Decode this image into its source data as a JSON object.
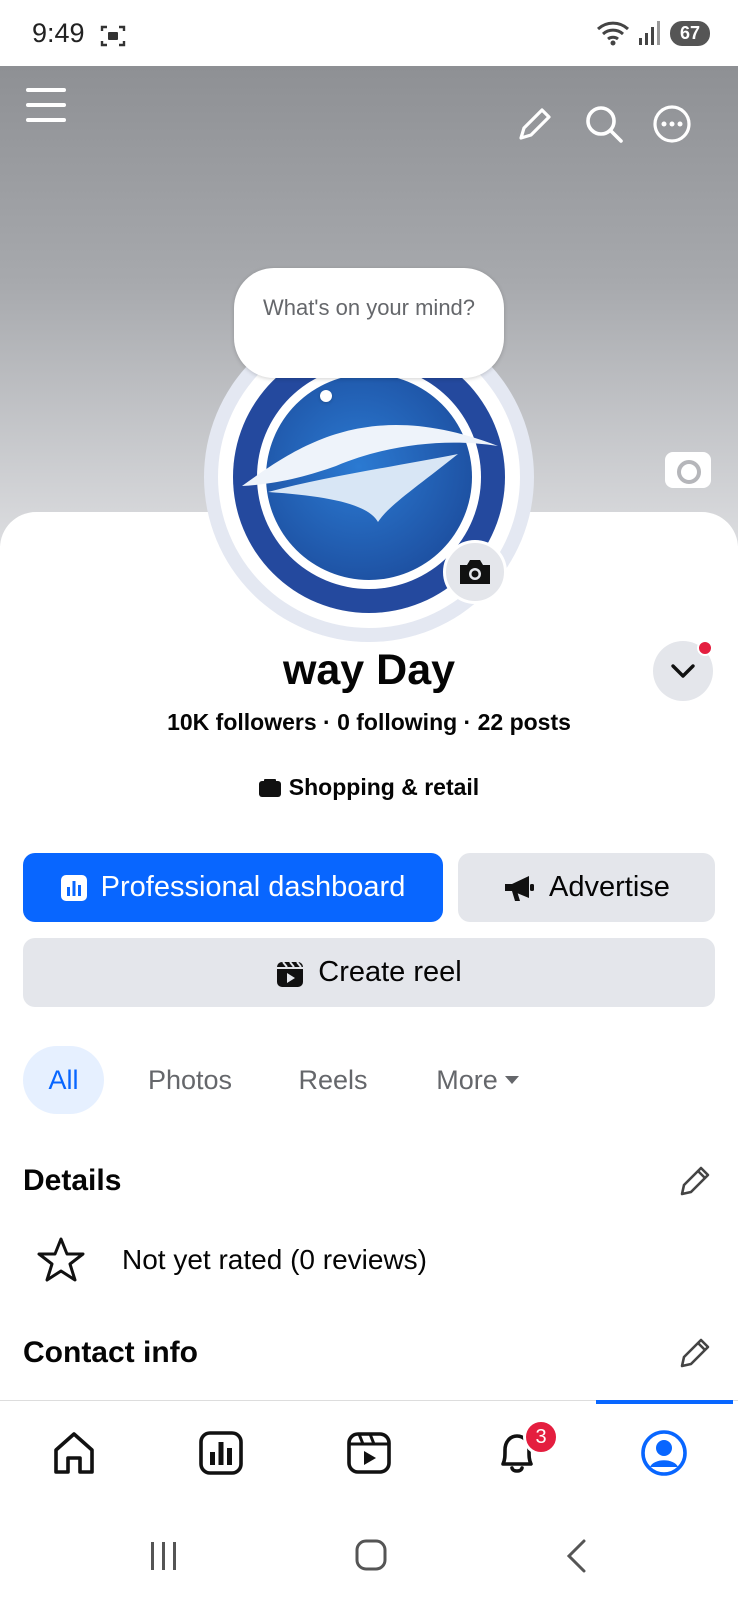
{
  "status_bar": {
    "time": "9:49",
    "battery": "67"
  },
  "profile": {
    "bubble_text": "What's on your mind?",
    "name": "way Day",
    "stats": "10K followers · 0 following · 22 posts",
    "category": "Shopping & retail"
  },
  "buttons": {
    "professional_dashboard": "Professional dashboard",
    "advertise": "Advertise",
    "create_reel": "Create reel"
  },
  "filters": {
    "all": "All",
    "photos": "Photos",
    "reels": "Reels",
    "more": "More"
  },
  "details": {
    "title": "Details",
    "rating": "Not yet rated (0 reviews)"
  },
  "contact": {
    "title": "Contact info"
  },
  "bottom_nav": {
    "notifications_badge": "3",
    "active": "profile"
  },
  "colors": {
    "accent": "#0866ff",
    "badge": "#e41e3f",
    "button_gray": "#e4e6eb"
  },
  "icons": [
    "menu-icon",
    "pencil-icon",
    "search-icon",
    "more-icon",
    "camera-icon",
    "chevron-down-icon",
    "store-icon",
    "dashboard-icon",
    "megaphone-icon",
    "reel-icon",
    "star-icon",
    "home-icon",
    "insights-icon",
    "video-icon",
    "bell-icon",
    "profile-icon"
  ]
}
